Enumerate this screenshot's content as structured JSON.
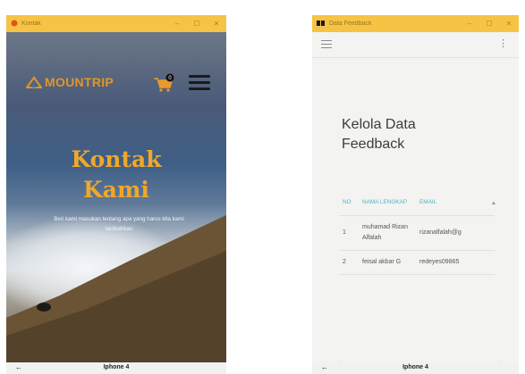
{
  "left_window": {
    "title": "Kontak",
    "controls": [
      "–",
      "☐",
      "✕"
    ],
    "brand": "MOUNTRIP",
    "cart_badge": "0",
    "hero_title_line1": "Kontak",
    "hero_title_line2": "Kami",
    "hero_subtitle": "Beri kami masukan tentang apa yang harus kita kami tambahkan",
    "device_label": "Iphone 4",
    "back_label": "←"
  },
  "right_window": {
    "title": "Data Feedback",
    "controls": [
      "–",
      "☐",
      "✕"
    ],
    "page_title": "Kelola Data Feedback",
    "table": {
      "headers": {
        "no": "NO",
        "nama": "NAMA LENGKAP",
        "email": "EMAIL"
      },
      "rows": [
        {
          "no": "1",
          "nama": "muhamad Rizan Alfalah",
          "email": "rizanalfalah@g"
        },
        {
          "no": "2",
          "nama": "feisal akbar G",
          "email": "redeyes09865"
        }
      ]
    },
    "device_label": "Iphone 4",
    "back_label": "←"
  },
  "colors": {
    "titlebar": "#f6c344",
    "accent_orange": "#f0a72a",
    "table_header": "#4db6c6"
  }
}
